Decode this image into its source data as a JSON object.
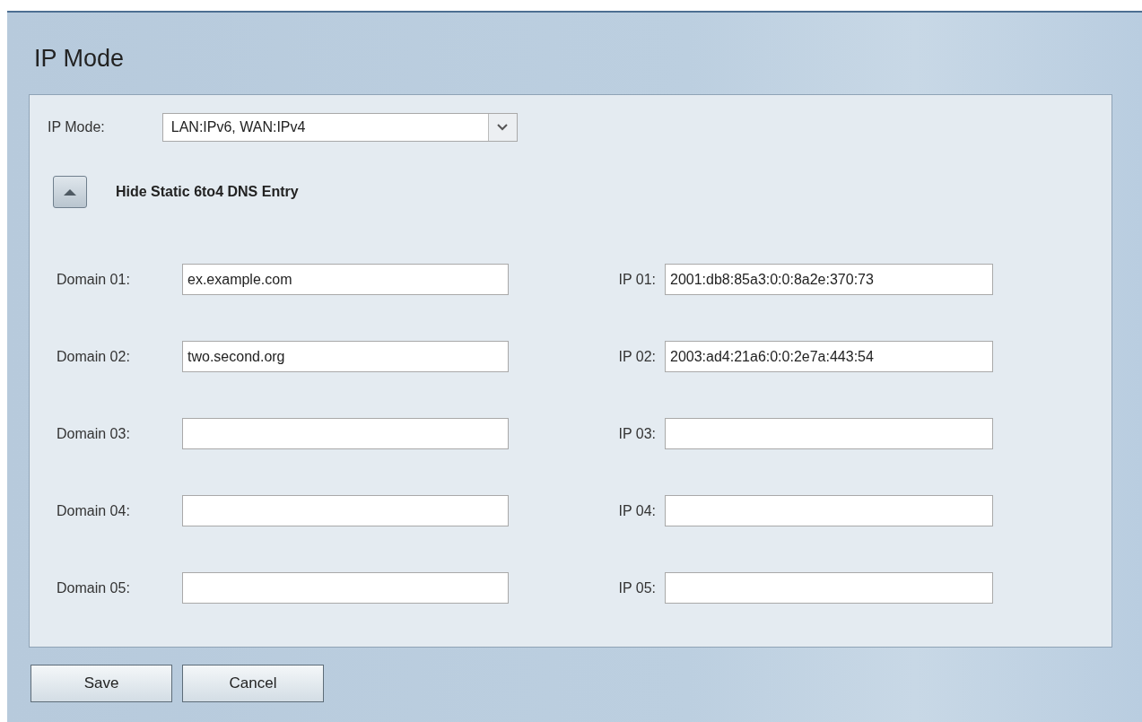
{
  "page_title": "IP Mode",
  "ip_mode": {
    "label": "IP Mode:",
    "value": "LAN:IPv6, WAN:IPv4"
  },
  "dns_toggle": {
    "label": "Hide Static 6to4 DNS Entry",
    "expanded": true
  },
  "entries": [
    {
      "domain_label": "Domain 01:",
      "domain": "ex.example.com",
      "ip_label": "IP 01:",
      "ip": "2001:db8:85a3:0:0:8a2e:370:73"
    },
    {
      "domain_label": "Domain 02:",
      "domain": "two.second.org",
      "ip_label": "IP 02:",
      "ip": "2003:ad4:21a6:0:0:2e7a:443:54"
    },
    {
      "domain_label": "Domain 03:",
      "ip_label": "IP 03:"
    },
    {
      "domain_label": "Domain 04:",
      "ip_label": "IP 04:"
    },
    {
      "domain_label": "Domain 05:",
      "ip_label": "IP 05:"
    }
  ],
  "buttons": [
    "Save",
    "Cancel"
  ]
}
